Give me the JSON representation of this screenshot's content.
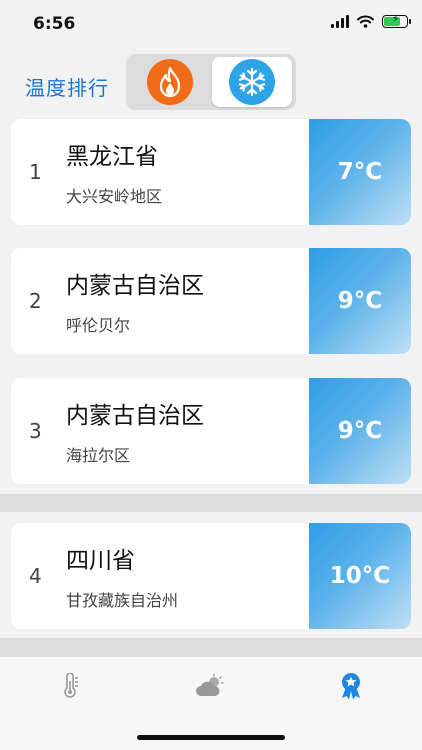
{
  "status": {
    "time": "6:56"
  },
  "header": {
    "title": "温度排行",
    "seg_hot_icon": "fire-icon",
    "seg_cold_icon": "snowflake-icon",
    "selected": "cold"
  },
  "rankings": [
    {
      "rank": "1",
      "province": "黑龙江省",
      "area": "大兴安岭地区",
      "temp": "7°C"
    },
    {
      "rank": "2",
      "province": "内蒙古自治区",
      "area": "呼伦贝尔",
      "temp": "9°C"
    },
    {
      "rank": "3",
      "province": "内蒙古自治区",
      "area": "海拉尔区",
      "temp": "9°C"
    },
    {
      "rank": "4",
      "province": "四川省",
      "area": "甘孜藏族自治州",
      "temp": "10°C"
    }
  ],
  "tabs": [
    {
      "icon": "thermometer-icon"
    },
    {
      "icon": "weather-icon"
    },
    {
      "icon": "award-badge-icon",
      "active": true
    }
  ],
  "colors": {
    "accent": "#1976d2",
    "temp_gradient_start": "#2f9ee6",
    "fire": "#f26b16",
    "snow": "#2ea3e6"
  }
}
